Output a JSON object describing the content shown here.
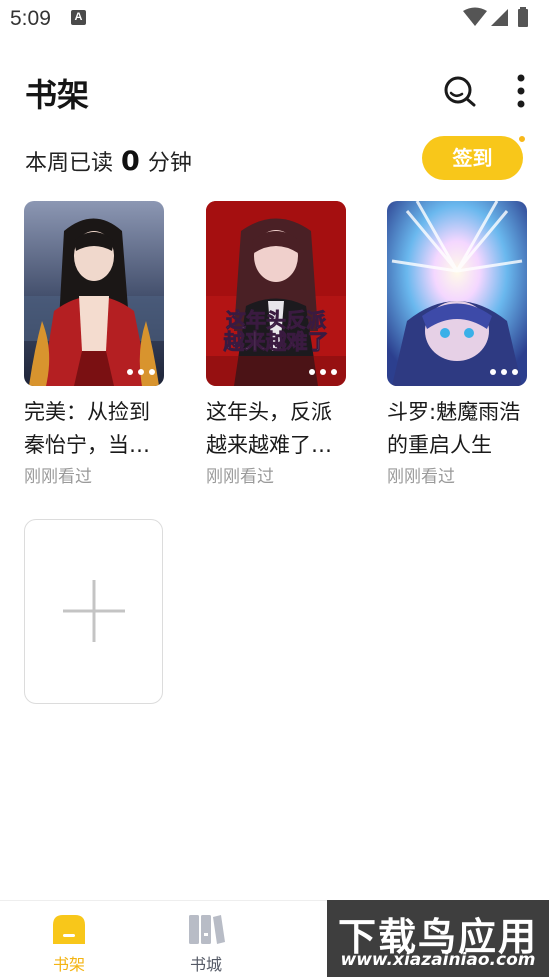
{
  "status_bar": {
    "time": "5:09",
    "notification_glyph": "A",
    "icons": [
      "wifi-icon",
      "signal-icon",
      "battery-icon"
    ]
  },
  "header": {
    "title": "书架",
    "icons": [
      "search-icon",
      "more-vertical-icon"
    ]
  },
  "reading": {
    "prefix": "本周已读",
    "minutes": "0",
    "suffix": "分钟",
    "checkin_label": "签到"
  },
  "books": [
    {
      "title": "完美：从捡到秦怡宁，当…",
      "meta": "刚刚看过"
    },
    {
      "title": "这年头，反派越来越难了…",
      "meta": "刚刚看过",
      "cover_text": [
        "这年头反派",
        "越来越难了"
      ]
    },
    {
      "title": "斗罗:魅魔雨浩的重启人生",
      "meta": "刚刚看过"
    }
  ],
  "add_book": {
    "icon": "plus-icon"
  },
  "bottom_nav": {
    "items": [
      {
        "label": "书架",
        "icon": "bookshelf-icon",
        "active": true
      },
      {
        "label": "书城",
        "icon": "bookstore-icon",
        "active": false
      }
    ]
  },
  "watermark": {
    "top": "下载鸟应用",
    "bottom": "www.xiazainiao.com"
  },
  "colors": {
    "accent": "#f8c71a",
    "text": "#1a1a1a",
    "muted": "#9a9a9a",
    "inactive_nav": "#b8bcc6"
  }
}
